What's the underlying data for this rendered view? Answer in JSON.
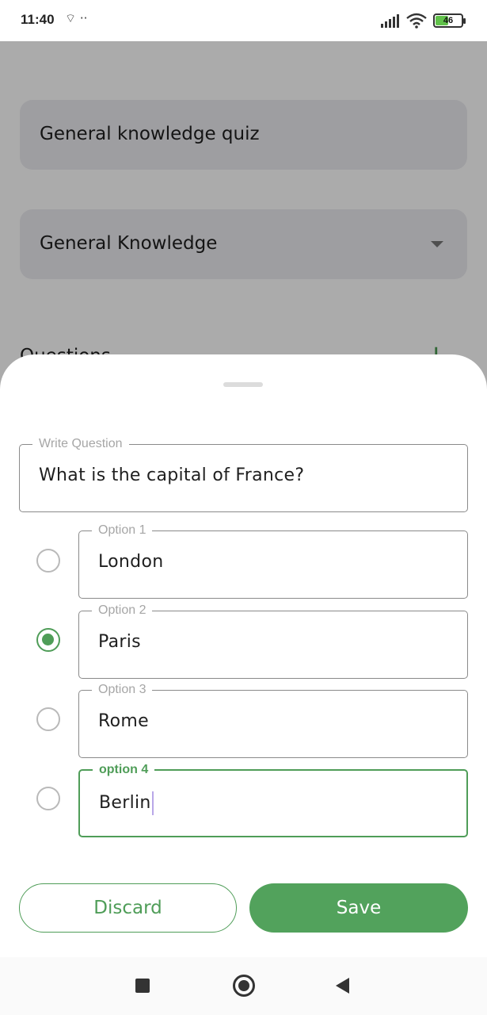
{
  "status_bar": {
    "time": "11:40",
    "left_icons": "⌔ ··",
    "battery_level": "46",
    "battery_fraction": 0.46,
    "right_icons": [
      "signal-icon",
      "wifi-icon",
      "battery-icon"
    ]
  },
  "background": {
    "quiz_title": "General knowledge quiz",
    "category": "General Knowledge",
    "section_title": "Questions",
    "add_icon": "+"
  },
  "sheet": {
    "question": {
      "label": "Write Question",
      "value": "What is the capital of France?"
    },
    "options": [
      {
        "label": "Option 1",
        "value": "London",
        "selected": false
      },
      {
        "label": "Option 2",
        "value": "Paris",
        "selected": true
      },
      {
        "label": "Option 3",
        "value": "Rome",
        "selected": false
      },
      {
        "label": "option 4",
        "value": "Berlin",
        "selected": false,
        "focused": true
      }
    ],
    "discard_label": "Discard",
    "save_label": "Save"
  },
  "colors": {
    "accent": "#4f9d58",
    "save_button": "#52a25c",
    "scrim": "rgba(0,0,0,0.33)"
  }
}
